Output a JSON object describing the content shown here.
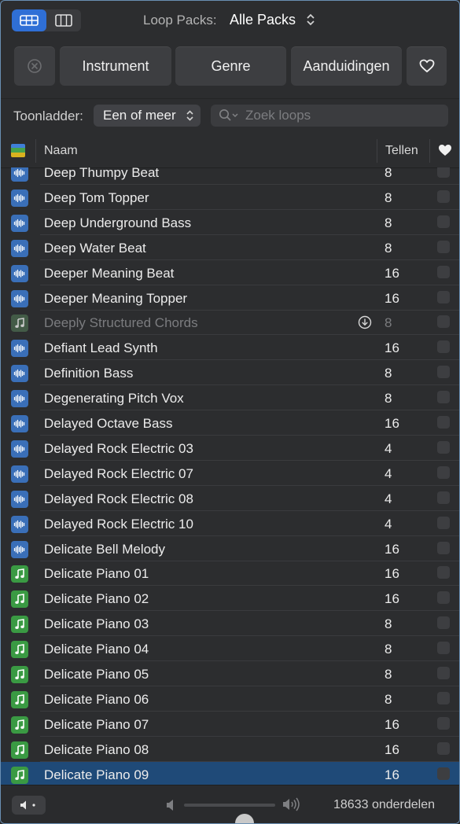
{
  "toolbar": {
    "loop_packs_label": "Loop Packs:",
    "loop_packs_value": "Alle Packs",
    "view_mode": "button-view"
  },
  "filters": {
    "clear_icon": "clear-x-icon",
    "buttons": [
      "Instrument",
      "Genre",
      "Aanduidingen"
    ],
    "favorites_icon": "heart-icon"
  },
  "scale": {
    "label": "Toonladder:",
    "value": "Een of meer"
  },
  "search": {
    "placeholder": "Zoek loops",
    "value": ""
  },
  "table": {
    "col_type_icon": "loop-type-icon",
    "col_name": "Naam",
    "col_beats": "Tellen",
    "col_fav_icon": "heart-icon",
    "rows": [
      {
        "name": "Deep Thumpy Beat",
        "beats": "8",
        "type": "audio"
      },
      {
        "name": "Deep Tom Topper",
        "beats": "8",
        "type": "audio"
      },
      {
        "name": "Deep Underground Bass",
        "beats": "8",
        "type": "audio"
      },
      {
        "name": "Deep Water Beat",
        "beats": "8",
        "type": "audio"
      },
      {
        "name": "Deeper Meaning Beat",
        "beats": "16",
        "type": "audio"
      },
      {
        "name": "Deeper Meaning Topper",
        "beats": "16",
        "type": "audio"
      },
      {
        "name": "Deeply Structured Chords",
        "beats": "8",
        "type": "midi",
        "disabled": true,
        "download": true
      },
      {
        "name": "Defiant Lead Synth",
        "beats": "16",
        "type": "audio"
      },
      {
        "name": "Definition Bass",
        "beats": "8",
        "type": "audio"
      },
      {
        "name": "Degenerating Pitch Vox",
        "beats": "8",
        "type": "audio"
      },
      {
        "name": "Delayed Octave Bass",
        "beats": "16",
        "type": "audio"
      },
      {
        "name": "Delayed Rock Electric 03",
        "beats": "4",
        "type": "audio"
      },
      {
        "name": "Delayed Rock Electric 07",
        "beats": "4",
        "type": "audio"
      },
      {
        "name": "Delayed Rock Electric 08",
        "beats": "4",
        "type": "audio"
      },
      {
        "name": "Delayed Rock Electric 10",
        "beats": "4",
        "type": "audio"
      },
      {
        "name": "Delicate Bell Melody",
        "beats": "16",
        "type": "audio"
      },
      {
        "name": "Delicate Piano 01",
        "beats": "16",
        "type": "midi"
      },
      {
        "name": "Delicate Piano 02",
        "beats": "16",
        "type": "midi"
      },
      {
        "name": "Delicate Piano 03",
        "beats": "8",
        "type": "midi"
      },
      {
        "name": "Delicate Piano 04",
        "beats": "8",
        "type": "midi"
      },
      {
        "name": "Delicate Piano 05",
        "beats": "8",
        "type": "midi"
      },
      {
        "name": "Delicate Piano 06",
        "beats": "8",
        "type": "midi"
      },
      {
        "name": "Delicate Piano 07",
        "beats": "16",
        "type": "midi"
      },
      {
        "name": "Delicate Piano 08",
        "beats": "16",
        "type": "midi"
      },
      {
        "name": "Delicate Piano 09",
        "beats": "16",
        "type": "midi",
        "selected": true
      }
    ]
  },
  "footer": {
    "volume_level": 0.66,
    "count_text": "18633 onderdelen"
  },
  "colors": {
    "accent": "#2f6fd6",
    "selection": "#1f4a78",
    "audio_icon": "#3a6fb8",
    "midi_icon": "#3a9a43",
    "background": "#2c2d2f"
  }
}
